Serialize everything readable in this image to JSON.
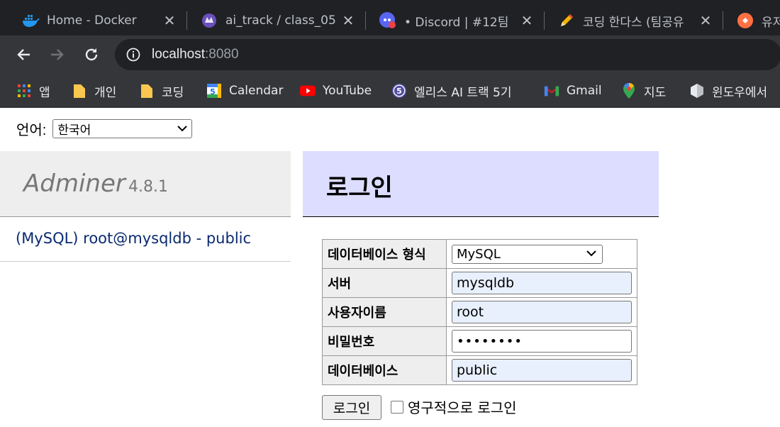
{
  "browser": {
    "tabs": [
      {
        "title": "Home - Docker",
        "icon": "docker-icon",
        "active": false
      },
      {
        "title": "ai_track / class_05",
        "icon": "gitlab-icon",
        "active": false
      },
      {
        "title": "• Discord | #12팀",
        "icon": "discord-icon",
        "active": false
      },
      {
        "title": "코딩 한다스 (팀공유",
        "icon": "pencil-icon",
        "active": false
      },
      {
        "title": "유저",
        "icon": "app-icon",
        "active": false
      }
    ],
    "close_glyph": "✕",
    "url_host": "localhost",
    "url_port": ":8080",
    "bookmarks": [
      {
        "label": "앱",
        "icon": "apps-grid-icon"
      },
      {
        "label": "개인",
        "icon": "folder-icon"
      },
      {
        "label": "코딩",
        "icon": "folder-icon"
      },
      {
        "label": "Calendar",
        "icon": "calendar-icon",
        "badge": "5"
      },
      {
        "label": "YouTube",
        "icon": "youtube-icon"
      },
      {
        "label": "엘리스 AI 트랙 5기",
        "icon": "elice-icon",
        "badge": "5"
      },
      {
        "label": "Gmail",
        "icon": "gmail-icon"
      },
      {
        "label": "지도",
        "icon": "maps-icon"
      },
      {
        "label": "윈도우에서",
        "icon": "hexagon-icon"
      }
    ]
  },
  "page": {
    "language_label": "언어:",
    "language_value": "한국어",
    "app_name": "Adminer",
    "app_version": "4.8.1",
    "db_link": "(MySQL) root@mysqldb - public",
    "title": "로그인",
    "form": {
      "system_label": "데이터베이스 형식",
      "system_value": "MySQL",
      "server_label": "서버",
      "server_value": "mysqldb",
      "username_label": "사용자이름",
      "username_value": "root",
      "password_label": "비밀번호",
      "password_value": "••••••••",
      "database_label": "데이터베이스",
      "database_value": "public"
    },
    "submit_label": "로그인",
    "permanent_label": "영구적으로 로그인"
  }
}
